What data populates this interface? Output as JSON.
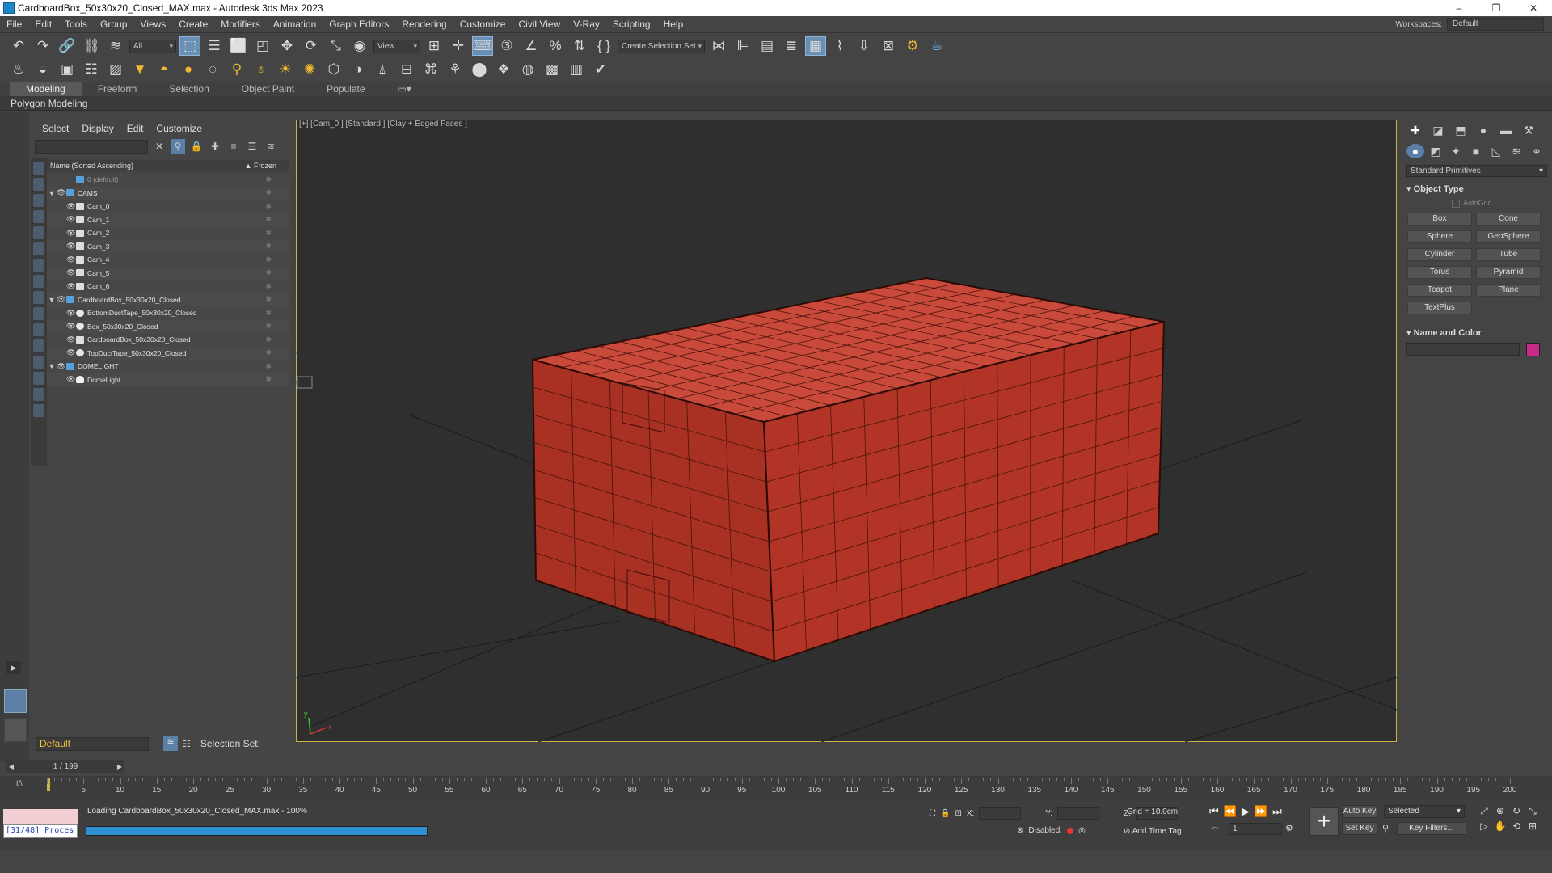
{
  "window": {
    "title": "CardboardBox_50x30x20_Closed_MAX.max - Autodesk 3ds Max 2023",
    "controls": [
      "–",
      "❐",
      "✕"
    ]
  },
  "menu": {
    "items": [
      "File",
      "Edit",
      "Tools",
      "Group",
      "Views",
      "Create",
      "Modifiers",
      "Animation",
      "Graph Editors",
      "Rendering",
      "Customize",
      "Civil View",
      "V-Ray",
      "Scripting",
      "Help"
    ],
    "workspaces_label": "Workspaces:",
    "workspace_value": "Default"
  },
  "toolbar": {
    "filter_value": "All",
    "ref_coord_value": "View",
    "selection_set_value": "Create Selection Set"
  },
  "ribbon": {
    "tabs": [
      "Modeling",
      "Freeform",
      "Selection",
      "Object Paint",
      "Populate"
    ],
    "active_tab": "Modeling",
    "panel_label": "Polygon Modeling"
  },
  "scene_explorer": {
    "menu": [
      "Select",
      "Display",
      "Edit",
      "Customize"
    ],
    "column_name": "Name (Sorted Ascending)",
    "column_frozen": "▲ Frozen",
    "rows": [
      {
        "name": "0 (default)",
        "level": 1,
        "icon": "layer",
        "dim": true
      },
      {
        "name": "CAMS",
        "level": 0,
        "icon": "layer"
      },
      {
        "name": "Cam_0",
        "level": 1,
        "icon": "camera"
      },
      {
        "name": "Cam_1",
        "level": 1,
        "icon": "camera"
      },
      {
        "name": "Cam_2",
        "level": 1,
        "icon": "camera"
      },
      {
        "name": "Cam_3",
        "level": 1,
        "icon": "camera"
      },
      {
        "name": "Cam_4",
        "level": 1,
        "icon": "camera"
      },
      {
        "name": "Cam_5",
        "level": 1,
        "icon": "camera"
      },
      {
        "name": "Cam_6",
        "level": 1,
        "icon": "camera"
      },
      {
        "name": "CardboardBox_50x30x20_Closed",
        "level": 0,
        "icon": "layer"
      },
      {
        "name": "BottomDuctTape_50x30x20_Closed",
        "level": 1,
        "icon": "sphere"
      },
      {
        "name": "Box_50x30x20_Closed",
        "level": 1,
        "icon": "sphere"
      },
      {
        "name": "CardboardBox_50x30x20_Closed",
        "level": 1,
        "icon": "group"
      },
      {
        "name": "TopDuctTape_50x30x20_Closed",
        "level": 1,
        "icon": "sphere"
      },
      {
        "name": "DOMELIGHT",
        "level": 0,
        "icon": "layer"
      },
      {
        "name": "DomeLight",
        "level": 1,
        "icon": "light"
      }
    ],
    "layer_value": "Default",
    "selection_set_label": "Selection Set:"
  },
  "viewport": {
    "label": "[+] [Cam_0 ] [Standard ] [Clay + Edged Faces ]",
    "axis_x": "x",
    "axis_y": "y"
  },
  "command_panel": {
    "category_value": "Standard Primitives",
    "object_type_title": "Object Type",
    "autogrid_label": "AutoGrid",
    "buttons": [
      "Box",
      "Cone",
      "Sphere",
      "GeoSphere",
      "Cylinder",
      "Tube",
      "Torus",
      "Pyramid",
      "Teapot",
      "Plane",
      "TextPlus"
    ],
    "name_color_title": "Name and Color",
    "object_color": "#c82a8a"
  },
  "time": {
    "frame_display": "1 / 199",
    "ticks": [
      "5",
      "10",
      "15",
      "20",
      "25",
      "30",
      "35",
      "40",
      "45",
      "50",
      "55",
      "60",
      "65",
      "70",
      "75",
      "80",
      "85",
      "90",
      "95",
      "100",
      "105",
      "110",
      "115",
      "120",
      "125",
      "130",
      "135",
      "140",
      "145",
      "150",
      "155",
      "160",
      "165",
      "170",
      "175",
      "180",
      "185",
      "190",
      "195",
      "200"
    ],
    "current_frame": "1"
  },
  "status": {
    "maxscript_text": "[31/48] Proces",
    "loading_text": "Loading CardboardBox_50x30x20_Closed_MAX.max - 100%",
    "progress": 1.0,
    "x_label": "X:",
    "y_label": "Y:",
    "z_label": "Z:",
    "grid_text": "Grid = 10.0cm",
    "disabled_label": "Disabled:",
    "add_time_tag": "Add Time Tag",
    "auto_key": "Auto Key",
    "set_key": "Set Key",
    "selected_value": "Selected",
    "key_filters": "Key Filters..."
  },
  "colors": {
    "box_fill": "#b83a2c",
    "box_wire": "#3a0e08",
    "viewport_bg": "#2f2f2f",
    "accent": "#c8b44a"
  }
}
